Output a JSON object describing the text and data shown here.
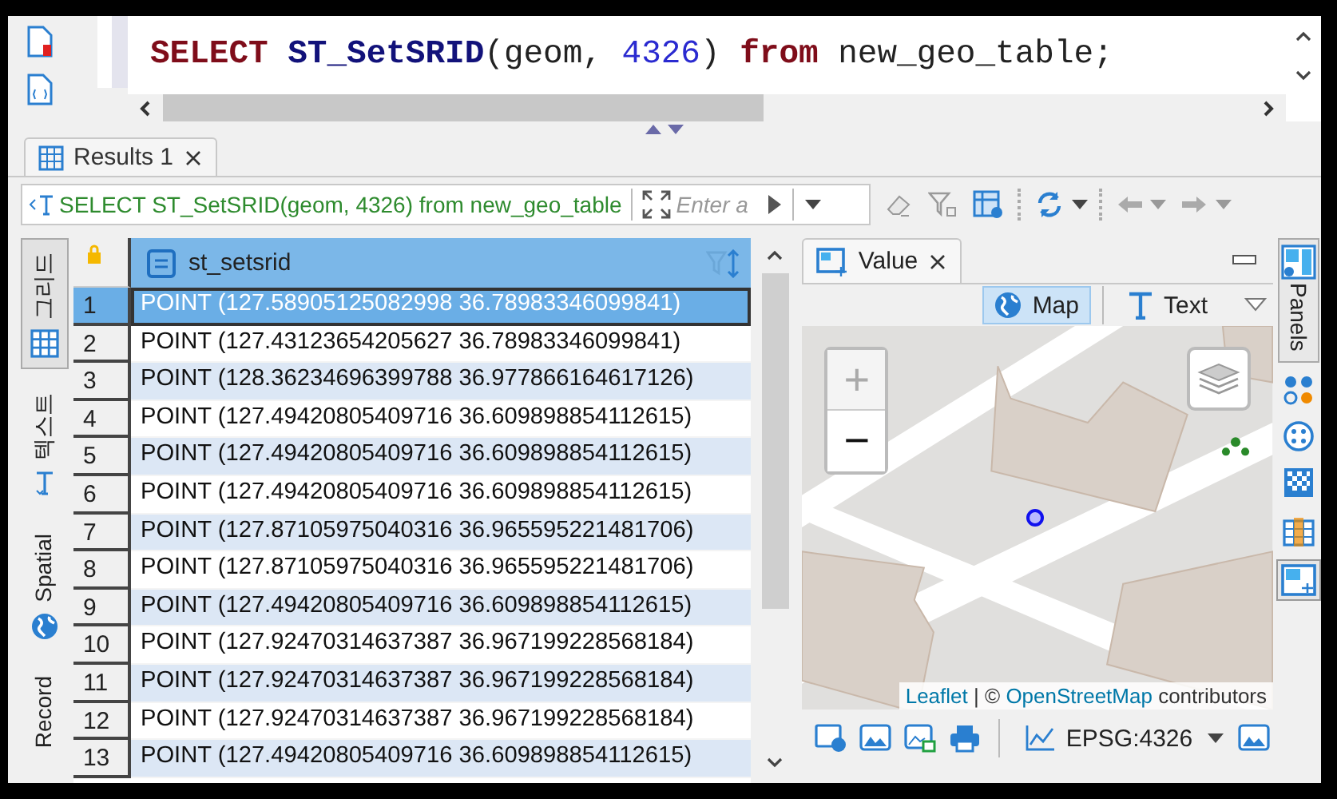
{
  "editor": {
    "sql": [
      {
        "text": "SELECT ",
        "kind": "keyword"
      },
      {
        "text": "ST_SetSRID",
        "kind": "function"
      },
      {
        "text": "(geom, ",
        "kind": "plain"
      },
      {
        "text": "4326",
        "kind": "number"
      },
      {
        "text": ") ",
        "kind": "plain"
      },
      {
        "text": "from ",
        "kind": "keyword"
      },
      {
        "text": "new_geo_table;",
        "kind": "plain"
      }
    ]
  },
  "result_tabs": [
    {
      "label": "Results 1",
      "selected": true
    }
  ],
  "filter": {
    "value": "SELECT ST_SetSRID(geom, 4326) from new_geo_table",
    "placeholder": "Enter a"
  },
  "side_tabs": [
    {
      "label": "그리드",
      "selected": true
    },
    {
      "label": "텍스트",
      "selected": false
    },
    {
      "label": "Spatial",
      "selected": false
    },
    {
      "label": "Record",
      "selected": false
    }
  ],
  "grid": {
    "column": "st_setsrid",
    "rows": [
      {
        "number": "1",
        "value": "POINT (127.58905125082998 36.78983346099841)",
        "selected": true
      },
      {
        "number": "2",
        "value": "POINT (127.43123654205627 36.78983346099841)",
        "selected": false
      },
      {
        "number": "3",
        "value": "POINT (128.36234696399788 36.977866164617126)",
        "selected": false
      },
      {
        "number": "4",
        "value": "POINT (127.49420805409716 36.609898854112615)",
        "selected": false
      },
      {
        "number": "5",
        "value": "POINT (127.49420805409716 36.609898854112615)",
        "selected": false
      },
      {
        "number": "6",
        "value": "POINT (127.49420805409716 36.609898854112615)",
        "selected": false
      },
      {
        "number": "7",
        "value": "POINT (127.87105975040316 36.965595221481706)",
        "selected": false
      },
      {
        "number": "8",
        "value": "POINT (127.87105975040316 36.965595221481706)",
        "selected": false
      },
      {
        "number": "9",
        "value": "POINT (127.49420805409716 36.609898854112615)",
        "selected": false
      },
      {
        "number": "10",
        "value": "POINT (127.92470314637387 36.967199228568184)",
        "selected": false
      },
      {
        "number": "11",
        "value": "POINT (127.92470314637387 36.967199228568184)",
        "selected": false
      },
      {
        "number": "12",
        "value": "POINT (127.92470314637387 36.967199228568184)",
        "selected": false
      },
      {
        "number": "13",
        "value": "POINT (127.49420805409716 36.609898854112615)",
        "selected": false
      }
    ]
  },
  "value_panel": {
    "tab": "Value",
    "modes": [
      {
        "label": "Map",
        "selected": true
      },
      {
        "label": "Text",
        "selected": false
      }
    ],
    "map": {
      "kind": "picture",
      "zoom_buttons": [
        "+",
        "−"
      ]
    },
    "attribution": [
      {
        "text": "Leaflet",
        "kind": "link"
      },
      {
        "text": " | © ",
        "kind": "plain"
      },
      {
        "text": "OpenStreetMap",
        "kind": "link"
      },
      {
        "text": " contributors",
        "kind": "plain"
      }
    ],
    "crs": "EPSG:4326"
  },
  "panels_tab": {
    "label": "Panels"
  }
}
